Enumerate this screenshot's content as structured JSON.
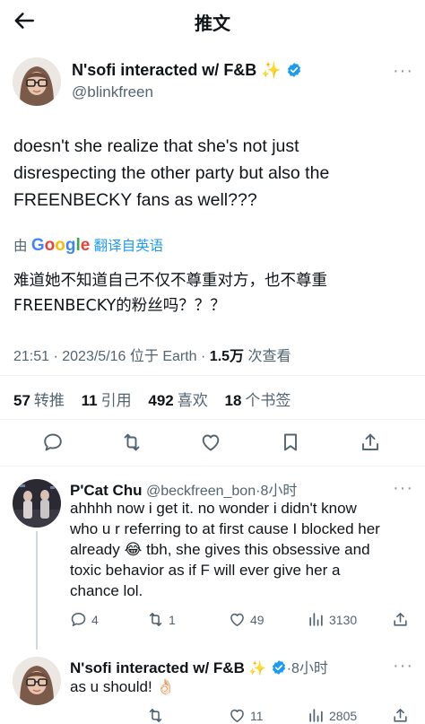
{
  "header": {
    "title": "推文"
  },
  "tweet": {
    "author_name": "N'sofi interacted w/ F&B",
    "author_emoji": "✨",
    "handle": "@blinkfreen",
    "text_lines": [
      "doesn't she realize that she's not just",
      "disrespecting the other party but also the",
      "FREENBECKY fans as well???"
    ],
    "translate_prefix": "由",
    "translate_brand": "Google",
    "translate_label": "翻译自英语",
    "translated_lines": [
      "难道她不知道自己不仅不尊重对方，也不尊重",
      "FREENBECKY的粉丝吗？？？"
    ],
    "meta_time": "21:51 · 2023/5/16 位于 Earth · ",
    "meta_views_count": "1.5万",
    "meta_views_label": " 次查看",
    "stats": {
      "retweets_count": "57",
      "retweets_label": "转推",
      "quotes_count": "11",
      "quotes_label": "引用",
      "likes_count": "492",
      "likes_label": "喜欢",
      "bookmarks_count": "18",
      "bookmarks_label": "个书签"
    }
  },
  "replies": [
    {
      "name": "P'Cat Chu",
      "handle": "@beckfreen_bon",
      "time": "·8小时",
      "text_lines": [
        "ahhhh now i get it. no wonder i didn't know",
        "who u r referring to at first cause I blocked her",
        "already 😂 tbh, she gives this obsessive and",
        "toxic behavior as if F will ever give her a",
        "chance lol."
      ],
      "replies": "4",
      "retweets": "1",
      "likes": "49",
      "views": "3130"
    },
    {
      "name": "N'sofi interacted w/ F&B",
      "emoji": "✨",
      "time": "·8小时",
      "text": "as u should! 👌🏻",
      "likes": "11",
      "views": "2805"
    }
  ],
  "colors": {
    "accent": "#1d9bf0",
    "text": "#0f1419",
    "muted": "#536471",
    "verified": "#1d9bf0"
  }
}
